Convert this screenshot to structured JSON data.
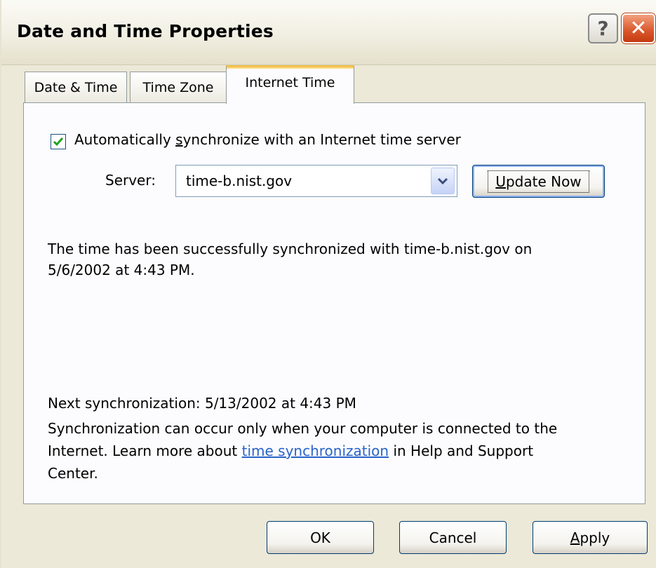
{
  "window": {
    "title": "Date and Time Properties",
    "help_glyph": "?",
    "close_glyph": "✕"
  },
  "tabs": [
    {
      "label": "Date & Time"
    },
    {
      "label": "Time Zone"
    },
    {
      "label": "Internet Time",
      "selected": true
    }
  ],
  "sync": {
    "checkbox_checked": true,
    "checkbox_label_pre": "Automatically ",
    "checkbox_label_accel": "s",
    "checkbox_label_post": "ynchronize with an Internet time server",
    "server_label": "Server:",
    "server_value": "time-b.nist.gov",
    "update_accel": "U",
    "update_rest": "pdate Now"
  },
  "status": {
    "line1": "The time has been successfully synchronized with time-b.nist.gov on",
    "line2": "5/6/2002 at 4:43 PM.",
    "next_sync": "Next synchronization: 5/13/2002 at 4:43 PM",
    "info_line1": "Synchronization can occur only when your computer is connected to the",
    "info_line2_pre": "Internet.  Learn more about ",
    "info_link": "time synchronization",
    "info_line2_post": " in Help and Support",
    "info_line3": "Center."
  },
  "buttons": {
    "ok": "OK",
    "cancel": "Cancel",
    "apply_accel": "A",
    "apply_rest": "pply"
  },
  "colors": {
    "dialog_bg": "#ece9d8",
    "selected_tab_accent": "#f3c04f",
    "link": "#2a63c9",
    "close_button": "#d9562a",
    "checkmark": "#21a121"
  }
}
